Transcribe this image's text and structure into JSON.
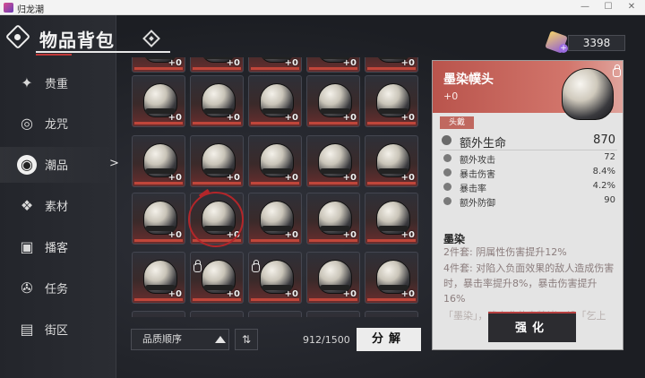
{
  "window": {
    "title": "归龙潮",
    "minimize": "—",
    "maximize": "☐",
    "close": "✕"
  },
  "header": {
    "title": "物品背包"
  },
  "currency": {
    "amount": "3398"
  },
  "nav": {
    "items": [
      {
        "label": "贵重",
        "icon": "gem-icon",
        "glyph": "✦"
      },
      {
        "label": "龙咒",
        "icon": "disc-icon",
        "glyph": "◎"
      },
      {
        "label": "潮品",
        "icon": "fashion-icon",
        "glyph": "◉",
        "active": true
      },
      {
        "label": "素材",
        "icon": "cube-icon",
        "glyph": "❖"
      },
      {
        "label": "播客",
        "icon": "podcast-icon",
        "glyph": "▣"
      },
      {
        "label": "任务",
        "icon": "reel-icon",
        "glyph": "✇"
      },
      {
        "label": "街区",
        "icon": "block-icon",
        "glyph": "▤"
      }
    ],
    "active_arrow": ">"
  },
  "grid": {
    "level_label": "+0",
    "cells": [
      {
        "locked": false
      },
      {
        "locked": false
      },
      {
        "locked": false
      },
      {
        "locked": false
      },
      {
        "locked": false
      },
      {
        "locked": false
      },
      {
        "locked": false
      },
      {
        "locked": false
      },
      {
        "locked": false
      },
      {
        "locked": false
      },
      {
        "locked": false
      },
      {
        "locked": false
      },
      {
        "locked": false
      },
      {
        "locked": false
      },
      {
        "locked": false
      },
      {
        "locked": false
      },
      {
        "locked": true,
        "selected": true
      },
      {
        "locked": true
      },
      {
        "locked": false
      },
      {
        "locked": false
      },
      {
        "locked": false
      },
      {
        "locked": false
      },
      {
        "locked": false
      },
      {
        "locked": true
      },
      {
        "locked": false
      }
    ]
  },
  "controls": {
    "sort_label": "品质顺序",
    "order_toggle": "⇅",
    "capacity": "912/1500",
    "decompose_label": "分解"
  },
  "detail": {
    "name": "墨染幞头",
    "level": "+0",
    "slot": "头戴",
    "main_stat": {
      "label": "额外生命",
      "value": "870"
    },
    "sub_stats": [
      {
        "label": "额外攻击",
        "value": "72",
        "icon": "sword-icon"
      },
      {
        "label": "暴击伤害",
        "value": "8.4%",
        "icon": "crit-damage-icon"
      },
      {
        "label": "暴击率",
        "value": "4.2%",
        "icon": "crit-rate-icon"
      },
      {
        "label": "额外防御",
        "value": "90",
        "icon": "shield-icon"
      }
    ],
    "set_name": "墨染",
    "set_bonuses": [
      "2件套: 阴属性伤害提升12%",
      "4件套: 对陷入负面效果的敌人造成伤害时，暴击率提升8%，暴击伤害提升16%",
      "「墨染」，珞上收盐奥牌诸，设「乞上"
    ],
    "enhance_label": "强化"
  },
  "colors": {
    "accent": "#c0463a",
    "panel_head": "#c0685f",
    "panel_bg": "#e4e4e4"
  }
}
